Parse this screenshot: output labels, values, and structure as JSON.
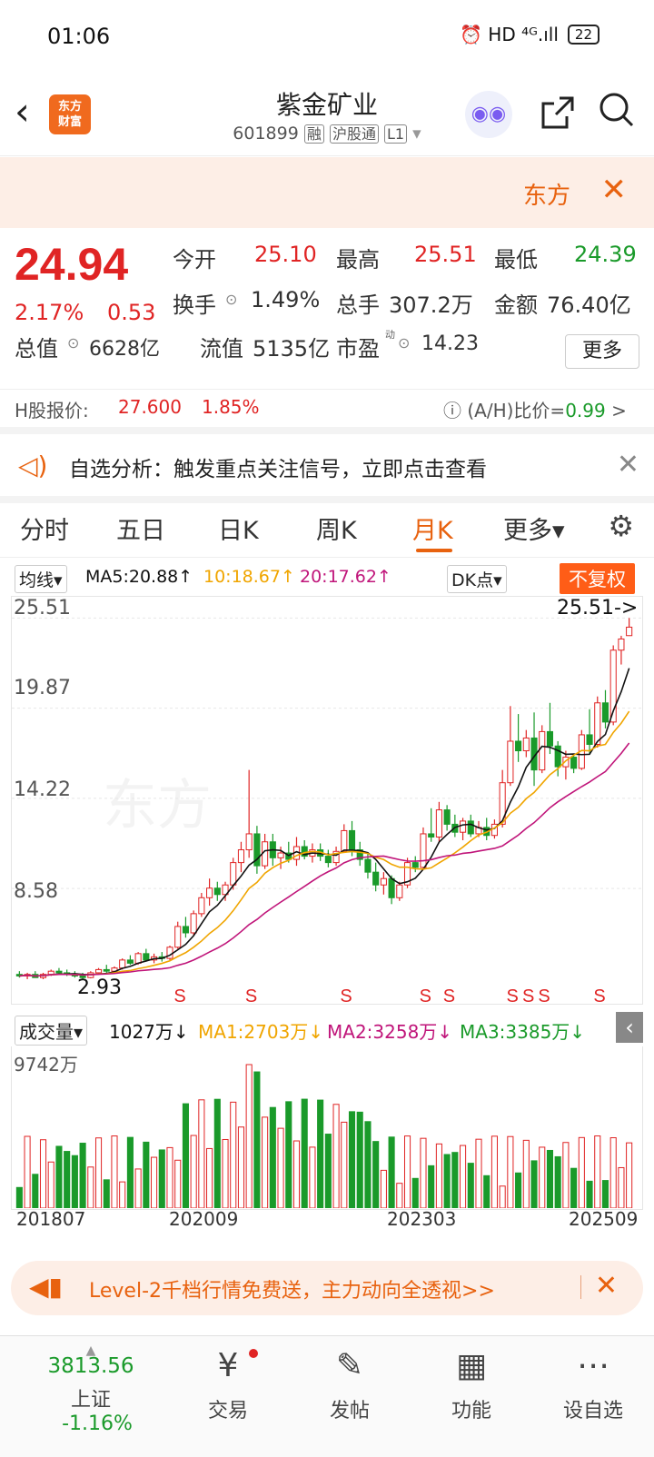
{
  "status": {
    "time": "01:06",
    "icons": "⏰ HD ⁴ᴳ.ıll",
    "battery": "22"
  },
  "header": {
    "back": "‹",
    "logo_line1": "东方",
    "logo_line2": "财富",
    "title": "紫金矿业",
    "code": "601899",
    "tag1": "融",
    "tag2": "沪股通",
    "tag3": "L1",
    "dropdown": "▾"
  },
  "banner": {
    "text": "东方",
    "close": "✕"
  },
  "quote": {
    "price": "24.94",
    "pct": "2.17%",
    "chg": "0.53",
    "open_label": "今开",
    "open": "25.10",
    "high_label": "最高",
    "high": "25.51",
    "low_label": "最低",
    "low": "24.39",
    "turnover_label": "换手",
    "turnover": "1.49%",
    "volume_label": "总手",
    "volume": "307.2万",
    "amount_label": "金额",
    "amount": "76.40亿",
    "mktcap_label": "总值",
    "mktcap": "6628亿",
    "float_label": "流值",
    "float": "5135亿",
    "pe_label": "市盈",
    "pe_sup": "动",
    "pe": "14.23",
    "more": "更多",
    "h_label": "H股报价:",
    "h_price": "27.600",
    "h_pct": "1.85%",
    "ah_label": "(A/H)比价=",
    "ah_value": "0.99",
    "ah_arrow": ">"
  },
  "analysis": {
    "text": "自选分析：触发重点关注信号，立即点击查看",
    "close": "✕"
  },
  "tabs": [
    "分时",
    "五日",
    "日K",
    "周K",
    "月K",
    "更多▾"
  ],
  "active_tab": "月K",
  "chart_toolbar": {
    "ma_select": "均线▾",
    "ma5": "MA5:20.88↑",
    "ma10": "10:18.67↑",
    "ma20": "20:17.62↑",
    "dk": "DK点▾",
    "fq": "不复权"
  },
  "price_axis": [
    "25.51",
    "19.87",
    "14.22",
    "8.58"
  ],
  "chart_annotations": {
    "high_marker": "25.51->",
    "low_marker": "2.93",
    "signal": "S"
  },
  "volume_toolbar": {
    "select": "成交量▾",
    "current": "1027万↓",
    "ma1": "MA1:2703万↓",
    "ma2": "MA2:3258万↓",
    "ma3": "MA3:3385万↓",
    "collapse": "‹"
  },
  "volume_axis": "9742万",
  "dates": [
    "201807",
    "202009",
    "202303",
    "202509"
  ],
  "level2": {
    "text": "Level-2千档行情免费送，主力动向全透视>>",
    "close": "✕"
  },
  "bottom_nav": {
    "index_value": "3813.56",
    "index_name": "上证",
    "index_pct": "-1.16%",
    "items": [
      {
        "icon": "¥",
        "label": "交易"
      },
      {
        "icon": "✎",
        "label": "发帖"
      },
      {
        "icon": "▦",
        "label": "功能"
      },
      {
        "icon": "⋯",
        "label": "设自选"
      }
    ]
  },
  "colors": {
    "up": "#e02424",
    "down": "#1a9a2a",
    "accent": "#e8620f",
    "ma5": "#111111",
    "ma10": "#f0a500",
    "ma20": "#c0157a"
  },
  "chart_data": {
    "type": "candlestick",
    "ylim": [
      2.5,
      26.5
    ],
    "candles": [
      [
        3.2,
        3.4,
        3.0,
        3.1
      ],
      [
        3.1,
        3.3,
        2.9,
        3.2
      ],
      [
        3.2,
        3.4,
        3.0,
        3.0
      ],
      [
        3.0,
        3.3,
        2.9,
        3.2
      ],
      [
        3.2,
        3.5,
        3.1,
        3.4
      ],
      [
        3.4,
        3.6,
        3.2,
        3.3
      ],
      [
        3.3,
        3.5,
        3.1,
        3.2
      ],
      [
        3.2,
        3.4,
        3.0,
        3.1
      ],
      [
        3.1,
        3.3,
        2.93,
        3.0
      ],
      [
        3.0,
        3.4,
        2.95,
        3.3
      ],
      [
        3.3,
        3.6,
        3.2,
        3.5
      ],
      [
        3.5,
        3.8,
        3.3,
        3.4
      ],
      [
        3.4,
        3.7,
        3.3,
        3.6
      ],
      [
        3.6,
        4.2,
        3.5,
        4.1
      ],
      [
        4.1,
        4.4,
        3.8,
        3.9
      ],
      [
        3.9,
        4.6,
        3.8,
        4.5
      ],
      [
        4.5,
        4.8,
        4.0,
        4.1
      ],
      [
        4.1,
        4.5,
        3.9,
        4.3
      ],
      [
        4.3,
        4.6,
        4.0,
        4.2
      ],
      [
        4.2,
        5.0,
        4.1,
        4.9
      ],
      [
        4.9,
        6.5,
        4.8,
        6.2
      ],
      [
        6.2,
        6.8,
        5.5,
        5.8
      ],
      [
        5.8,
        7.2,
        5.6,
        7.0
      ],
      [
        7.0,
        8.3,
        6.8,
        8.0
      ],
      [
        8.0,
        9.2,
        7.5,
        8.6
      ],
      [
        8.6,
        9.0,
        7.8,
        8.2
      ],
      [
        8.2,
        9.0,
        7.8,
        8.8
      ],
      [
        8.8,
        10.5,
        8.5,
        10.2
      ],
      [
        10.2,
        11.5,
        9.6,
        11.0
      ],
      [
        11.0,
        16.0,
        10.5,
        12.0
      ],
      [
        12.0,
        12.5,
        9.5,
        10.0
      ],
      [
        10.0,
        12.0,
        9.8,
        11.5
      ],
      [
        11.5,
        12.0,
        10.0,
        10.5
      ],
      [
        10.5,
        11.2,
        9.8,
        10.8
      ],
      [
        10.8,
        11.5,
        10.2,
        10.4
      ],
      [
        10.4,
        11.8,
        10.0,
        11.2
      ],
      [
        11.2,
        11.6,
        10.4,
        10.6
      ],
      [
        10.6,
        11.4,
        10.2,
        11.0
      ],
      [
        11.0,
        11.4,
        10.3,
        10.6
      ],
      [
        10.6,
        11.0,
        9.9,
        10.2
      ],
      [
        10.2,
        11.2,
        10.0,
        10.9
      ],
      [
        10.9,
        12.6,
        10.8,
        12.2
      ],
      [
        12.2,
        12.8,
        10.6,
        11.0
      ],
      [
        11.0,
        11.5,
        10.0,
        10.4
      ],
      [
        10.4,
        10.8,
        9.2,
        9.6
      ],
      [
        9.6,
        10.2,
        8.4,
        8.8
      ],
      [
        8.8,
        9.6,
        8.2,
        9.2
      ],
      [
        9.2,
        9.4,
        7.6,
        8.0
      ],
      [
        8.0,
        9.0,
        7.8,
        8.8
      ],
      [
        8.8,
        10.5,
        8.6,
        10.2
      ],
      [
        10.2,
        10.6,
        9.6,
        9.9
      ],
      [
        9.9,
        12.4,
        9.8,
        12.0
      ],
      [
        12.0,
        13.6,
        11.5,
        11.8
      ],
      [
        11.8,
        14.0,
        11.5,
        13.5
      ],
      [
        13.5,
        13.8,
        12.2,
        12.6
      ],
      [
        12.6,
        13.2,
        11.8,
        12.1
      ],
      [
        12.1,
        13.0,
        11.6,
        12.8
      ],
      [
        12.8,
        13.2,
        11.8,
        12.0
      ],
      [
        12.0,
        12.8,
        11.8,
        12.4
      ],
      [
        12.4,
        13.0,
        11.6,
        11.9
      ],
      [
        11.9,
        12.9,
        11.7,
        12.6
      ],
      [
        12.6,
        16.0,
        12.4,
        15.2
      ],
      [
        15.2,
        20.0,
        15.0,
        17.8
      ],
      [
        17.8,
        19.5,
        16.5,
        17.2
      ],
      [
        17.2,
        18.5,
        16.8,
        18.0
      ],
      [
        18.0,
        19.6,
        15.0,
        16.0
      ],
      [
        16.0,
        18.8,
        15.8,
        18.4
      ],
      [
        18.4,
        20.2,
        17.0,
        17.5
      ],
      [
        17.5,
        17.8,
        15.6,
        16.2
      ],
      [
        16.2,
        17.2,
        15.4,
        16.8
      ],
      [
        16.8,
        17.0,
        15.8,
        16.1
      ],
      [
        16.1,
        18.5,
        16.0,
        18.2
      ],
      [
        18.2,
        19.8,
        17.0,
        17.6
      ],
      [
        17.6,
        20.6,
        17.4,
        20.2
      ],
      [
        20.2,
        21.0,
        18.6,
        19.0
      ],
      [
        19.0,
        23.8,
        18.8,
        23.5
      ],
      [
        23.5,
        24.4,
        22.6,
        24.2
      ],
      [
        24.41,
        25.51,
        24.39,
        24.94
      ]
    ]
  }
}
